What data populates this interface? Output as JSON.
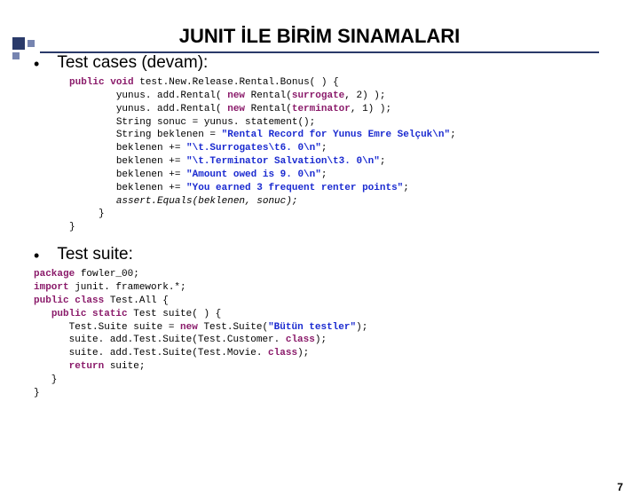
{
  "title": "JUNIT İLE BİRİM SINAMALARI",
  "section1": "Test cases (devam):",
  "section2": "Test suite:",
  "kw": {
    "public": "public",
    "void": "void",
    "new": "new",
    "package": "package",
    "import": "import",
    "class": "class",
    "static": "static",
    "return": "return"
  },
  "c1": {
    "m": "test.New.Release.Rental.Bonus( ) {",
    "l1a": "yunus. add.Rental( ",
    "l1b": " Rental(",
    "l1c": "surrogate",
    "l1d": ", 2) );",
    "l2a": "yunus. add.Rental( ",
    "l2b": " Rental(",
    "l2c": "terminator",
    "l2d": ", 1) );",
    "l3": "String sonuc = yunus. statement();",
    "l4a": "String beklenen = ",
    "l4b": "\"Rental Record for Yunus Emre Selçuk\\n\"",
    "l5a": "beklenen += ",
    "l5b": "\"\\t.Surrogates\\t6. 0\\n\"",
    "l6a": "beklenen += ",
    "l6b": "\"\\t.Terminator Salvation\\t3. 0\\n\"",
    "l7a": "beklenen += ",
    "l7b": "\"Amount owed is 9. 0\\n\"",
    "l8a": "beklenen += ",
    "l8b": "\"You earned 3 frequent renter points\"",
    "l9": "assert.Equals(beklenen, sonuc);"
  },
  "c2": {
    "pkg": " fowler_00;",
    "imp": " junit. framework.*;",
    "cls": " Test.All {",
    "sig": " Test suite( ) {",
    "l1a": "Test.Suite suite = ",
    "l1b": " Test.Suite(",
    "l1c": "\"Bütün testler\"",
    "l1d": ");",
    "l2a": "suite. add.Test.Suite(Test.Customer. ",
    "l2b": ");",
    "l3a": "suite. add.Test.Suite(Test.Movie. ",
    "l3b": ");",
    "ret": " suite;"
  },
  "page": "7"
}
